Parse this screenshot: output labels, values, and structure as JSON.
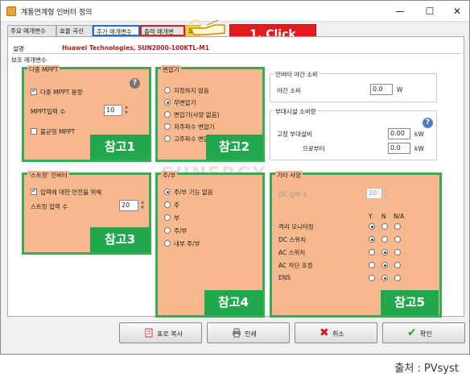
{
  "window": {
    "title": "계통연계형 인버터 정의",
    "minimize": "—",
    "maximize": "☐",
    "close": "✕"
  },
  "tabs": [
    "주요 매개변수",
    "효율 곡선",
    "추가 매개변수",
    "출력 매개변",
    "도"
  ],
  "click_callout": "1. Click",
  "header": {
    "desc_label": "설명",
    "model": "Huawei Technologies, SUN2000-100KTL-M1",
    "section": "보조 매개변수"
  },
  "multi_mppt": {
    "title": "다중 MPPT",
    "cb_label": "다중 MPPT 용량",
    "mppt_input_label": "MPPT입력 수",
    "mppt_input_value": "10",
    "unequal_label": "불균형 MPPT"
  },
  "transformer": {
    "title": "변압기",
    "options": [
      "지정하지 않음",
      "무변압기",
      "변압기(사양 없음)",
      "저주파수 변압기",
      "고주파수 변압기"
    ],
    "selected": 1
  },
  "night": {
    "title": "인버터 야간 소비",
    "label": "야간 소비",
    "value": "0.0",
    "unit": "W"
  },
  "aux": {
    "title": "부대시설 소비량",
    "l1": "고정 부대설비",
    "v1": "0.00",
    "u1": "kW",
    "l2": "으로부터",
    "v2": "0.0",
    "u2": "kW"
  },
  "string_inv": {
    "title": "'스트링' 인버터",
    "cb_label": "입력에 대한 안전을 위해",
    "label": "스트링 입력 수",
    "value": "20"
  },
  "master": {
    "title": "주/부",
    "options": [
      "주/부 기능 없음",
      "주",
      "부",
      "주/부",
      "내부 주/부"
    ],
    "selected": 0
  },
  "other": {
    "title": "기타 사양",
    "dc_label": "DC 입력 수",
    "dc_value": "20",
    "y": "Y",
    "n": "N",
    "na": "N/A",
    "rows": [
      "격리 모니터링",
      "DC 스위치",
      "AC 스위치",
      "AC 차단 조정",
      "ENS"
    ],
    "selected": [
      0,
      0,
      1,
      1,
      1
    ]
  },
  "refs": [
    "참고1",
    "참고2",
    "참고3",
    "참고4",
    "참고5"
  ],
  "watermark": "SUNERGY",
  "buttons": {
    "copy": "표로 복사",
    "print": "인쇄",
    "cancel": "취소",
    "ok": "확인"
  },
  "source": "출처 : PVsyst",
  "colors": {
    "accent_orange": "#f6b88c",
    "ref_green": "#21a84c",
    "callout_red": "#e21c1c"
  }
}
